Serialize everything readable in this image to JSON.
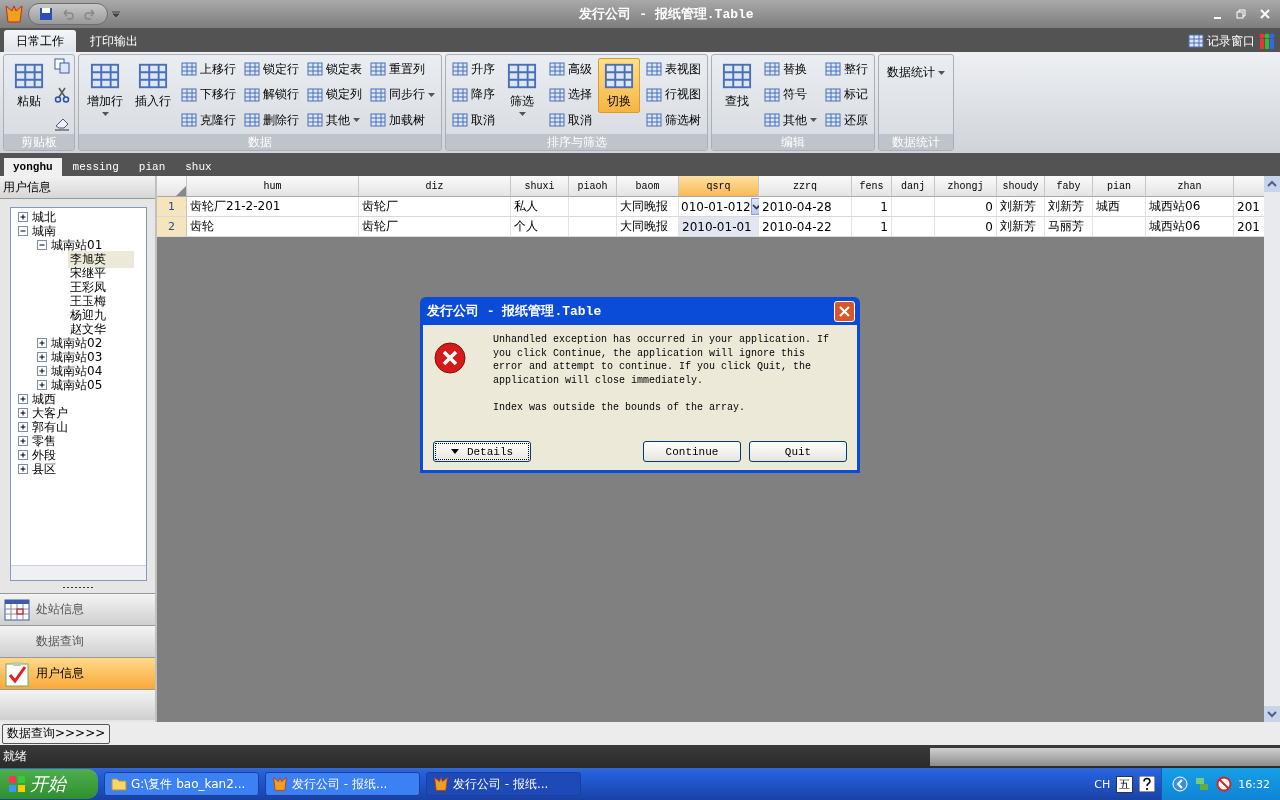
{
  "window": {
    "title": "发行公司 - 报纸管理.Table"
  },
  "ribbon_tabs": [
    {
      "label": "日常工作",
      "selected": true
    },
    {
      "label": "打印输出",
      "selected": false
    }
  ],
  "record_window": "记录窗口",
  "ribbon_groups": [
    {
      "title": "剪贴板",
      "columns": [
        [
          {
            "kind": "large",
            "label": "粘贴",
            "menu": false,
            "on": false
          }
        ],
        [
          {
            "kind": "icon"
          },
          {
            "kind": "icon"
          },
          {
            "kind": "icon"
          }
        ]
      ]
    },
    {
      "title": "数据",
      "columns": [
        [
          {
            "kind": "large",
            "label": "增加行",
            "menu": true,
            "on": false
          }
        ],
        [
          {
            "kind": "large",
            "label": "插入行",
            "menu": false,
            "on": false
          }
        ],
        [
          {
            "kind": "small",
            "label": "上移行",
            "menu": false,
            "on": false
          },
          {
            "kind": "small",
            "label": "下移行",
            "menu": false,
            "on": false
          },
          {
            "kind": "small",
            "label": "克隆行",
            "menu": false,
            "on": false
          }
        ],
        [
          {
            "kind": "small",
            "label": "锁定行",
            "menu": false,
            "on": false
          },
          {
            "kind": "small",
            "label": "解锁行",
            "menu": false,
            "on": false
          },
          {
            "kind": "small",
            "label": "删除行",
            "menu": false,
            "on": false
          }
        ],
        [
          {
            "kind": "small",
            "label": "锁定表",
            "menu": false,
            "on": false
          },
          {
            "kind": "small",
            "label": "锁定列",
            "menu": false,
            "on": false
          },
          {
            "kind": "small",
            "label": "其他",
            "menu": true,
            "on": false
          }
        ],
        [
          {
            "kind": "small",
            "label": "重置列",
            "menu": false,
            "on": false
          },
          {
            "kind": "small",
            "label": "同步行",
            "menu": true,
            "on": false
          },
          {
            "kind": "small",
            "label": "加载树",
            "menu": false,
            "on": false
          }
        ]
      ]
    },
    {
      "title": "排序与筛选",
      "columns": [
        [
          {
            "kind": "small",
            "label": "升序",
            "menu": false,
            "on": false
          },
          {
            "kind": "small",
            "label": "降序",
            "menu": false,
            "on": false
          },
          {
            "kind": "small",
            "label": "取消",
            "menu": false,
            "on": false
          }
        ],
        [
          {
            "kind": "large",
            "label": "筛选",
            "menu": true,
            "on": false
          }
        ],
        [
          {
            "kind": "small",
            "label": "高级",
            "menu": false,
            "on": false
          },
          {
            "kind": "small",
            "label": "选择",
            "menu": false,
            "on": false
          },
          {
            "kind": "small",
            "label": "取消",
            "menu": false,
            "on": false
          }
        ],
        [
          {
            "kind": "large",
            "label": "切换",
            "menu": false,
            "on": true
          }
        ],
        [
          {
            "kind": "small",
            "label": "表视图",
            "menu": false,
            "on": false
          },
          {
            "kind": "small",
            "label": "行视图",
            "menu": false,
            "on": false
          },
          {
            "kind": "small",
            "label": "筛选树",
            "menu": false,
            "on": false
          }
        ]
      ]
    },
    {
      "title": "编辑",
      "columns": [
        [
          {
            "kind": "large",
            "label": "查找",
            "menu": false,
            "on": false
          }
        ],
        [
          {
            "kind": "small",
            "label": "替换",
            "menu": false,
            "on": false
          },
          {
            "kind": "small",
            "label": "符号",
            "menu": false,
            "on": false
          },
          {
            "kind": "small",
            "label": "其他",
            "menu": true,
            "on": false
          }
        ],
        [
          {
            "kind": "small",
            "label": "整行",
            "menu": false,
            "on": false
          },
          {
            "kind": "small",
            "label": "标记",
            "menu": false,
            "on": false
          },
          {
            "kind": "small",
            "label": "还原",
            "menu": false,
            "on": false
          }
        ]
      ]
    },
    {
      "title": "数据统计",
      "columns": [
        [
          {
            "kind": "menu",
            "label": "数据统计",
            "menu": true,
            "on": false
          }
        ]
      ]
    }
  ],
  "doc_tabs": [
    {
      "label": "yonghu",
      "selected": true
    },
    {
      "label": "messing",
      "selected": false
    },
    {
      "label": "pian",
      "selected": false
    },
    {
      "label": "shux",
      "selected": false
    }
  ],
  "sidebar": {
    "header": "用户信息",
    "tree": [
      {
        "label": "城北",
        "expanded": false,
        "selected": false
      },
      {
        "label": "城南",
        "expanded": true,
        "selected": false,
        "children": [
          {
            "label": "城南站01",
            "expanded": true,
            "selected": false,
            "children": [
              {
                "label": "李旭英",
                "selected": true
              },
              {
                "label": "宋继平",
                "selected": false
              },
              {
                "label": "王彩凤",
                "selected": false
              },
              {
                "label": "王玉梅",
                "selected": false
              },
              {
                "label": "杨迎九",
                "selected": false
              },
              {
                "label": "赵文华",
                "selected": false
              }
            ]
          },
          {
            "label": "城南站02",
            "expanded": false,
            "selected": false
          },
          {
            "label": "城南站03",
            "expanded": false,
            "selected": false
          },
          {
            "label": "城南站04",
            "expanded": false,
            "selected": false
          },
          {
            "label": "城南站05",
            "expanded": false,
            "selected": false
          }
        ]
      },
      {
        "label": "城西",
        "expanded": false,
        "selected": false
      },
      {
        "label": "大客户",
        "expanded": false,
        "selected": false
      },
      {
        "label": "郭有山",
        "expanded": false,
        "selected": false
      },
      {
        "label": "零售",
        "expanded": false,
        "selected": false
      },
      {
        "label": "外段",
        "expanded": false,
        "selected": false
      },
      {
        "label": "县区",
        "expanded": false,
        "selected": false
      }
    ],
    "nav": [
      {
        "label": "处站信息",
        "selected": false,
        "kind": "calendar"
      },
      {
        "label": "数据查询",
        "selected": false,
        "kind": "plain"
      },
      {
        "label": "用户信息",
        "selected": true,
        "kind": "check"
      }
    ]
  },
  "grid": {
    "columns": [
      {
        "label": "hum",
        "selected": false
      },
      {
        "label": "diz",
        "selected": false
      },
      {
        "label": "shuxi",
        "selected": false
      },
      {
        "label": "piaoh",
        "selected": false
      },
      {
        "label": "baom",
        "selected": false
      },
      {
        "label": "qsrq",
        "selected": true
      },
      {
        "label": "zzrq",
        "selected": false
      },
      {
        "label": "fens",
        "selected": false
      },
      {
        "label": "danj",
        "selected": false
      },
      {
        "label": "zhongj",
        "selected": false
      },
      {
        "label": "shoudy",
        "selected": false
      },
      {
        "label": "faby",
        "selected": false
      },
      {
        "label": "pian",
        "selected": false
      },
      {
        "label": "zhan",
        "selected": false
      }
    ],
    "rows": [
      {
        "number": "1",
        "editing": true,
        "cells": [
          "齿轮厂21-2-201",
          "齿轮厂",
          "私人",
          null,
          "大同晚报",
          "010-01-012",
          "2010-04-28",
          "1",
          null,
          "0",
          "刘新芳",
          "刘新芳",
          "城西",
          "城西站06",
          "201"
        ]
      },
      {
        "number": "2",
        "editing": false,
        "cells": [
          "齿轮",
          "齿轮厂",
          "个人",
          null,
          "大同晚报",
          "2010-01-01",
          "2010-04-22",
          "1",
          null,
          "0",
          "刘新芳",
          "马丽芳",
          null,
          "城西站06",
          "201"
        ]
      }
    ]
  },
  "bottom_button": "数据查询>>>>>",
  "status": "就绪",
  "dialog": {
    "title": "发行公司 - 报纸管理.Table",
    "message": "Unhandled exception has occurred in your application. If you click Continue, the application will ignore this error and attempt to continue. If you click Quit, the application will close immediately.",
    "detail": "Index was outside the bounds of the array.",
    "buttons": [
      {
        "label": "Details",
        "kind": "details"
      },
      {
        "label": "Continue",
        "kind": "push"
      },
      {
        "label": "Quit",
        "kind": "push"
      }
    ]
  },
  "taskbar": {
    "start": "开始",
    "tasks": [
      {
        "label": "G:\\复件 bao_kan2...",
        "kind": "folder",
        "selected": false
      },
      {
        "label": "发行公司 - 报纸...",
        "kind": "app",
        "selected": false
      },
      {
        "label": "发行公司 - 报纸...",
        "kind": "app",
        "selected": true
      }
    ],
    "language": "CH",
    "ime": "五",
    "clock": "16:32"
  }
}
